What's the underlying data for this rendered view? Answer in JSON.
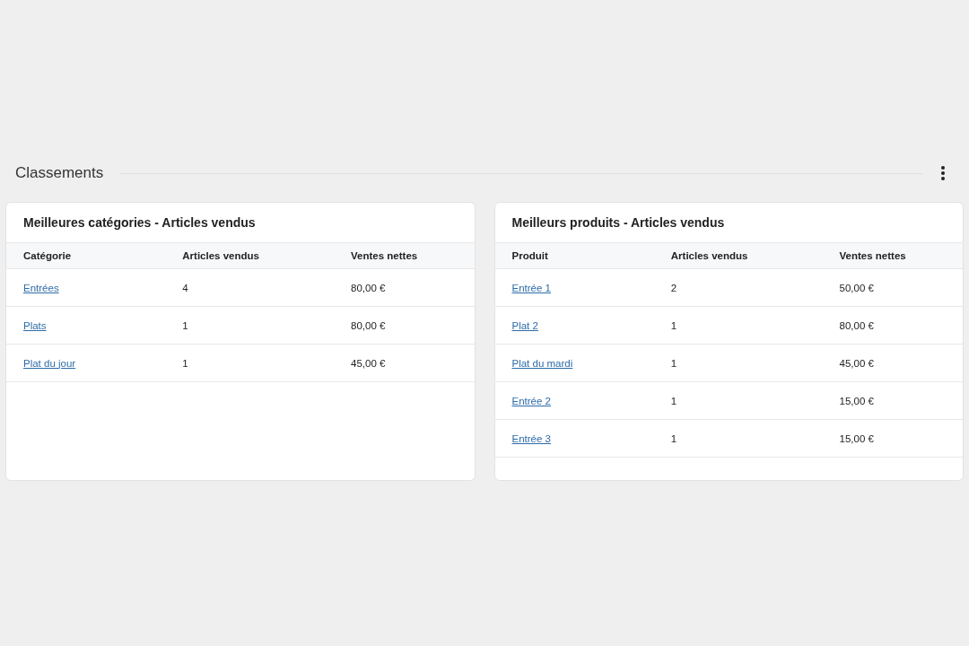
{
  "section": {
    "title": "Classements"
  },
  "cards": [
    {
      "title": "Meilleures catégories - Articles vendus",
      "columns": [
        "Catégorie",
        "Articles vendus",
        "Ventes nettes"
      ],
      "rows": [
        {
          "name": "Entrées",
          "sold": "4",
          "sales": "80,00 €"
        },
        {
          "name": "Plats",
          "sold": "1",
          "sales": "80,00 €"
        },
        {
          "name": "Plat du jour",
          "sold": "1",
          "sales": "45,00 €"
        }
      ]
    },
    {
      "title": "Meilleurs produits - Articles vendus",
      "columns": [
        "Produit",
        "Articles vendus",
        "Ventes nettes"
      ],
      "rows": [
        {
          "name": "Entrée 1",
          "sold": "2",
          "sales": "50,00 €"
        },
        {
          "name": "Plat 2",
          "sold": "1",
          "sales": "80,00 €"
        },
        {
          "name": "Plat du mardi",
          "sold": "1",
          "sales": "45,00 €"
        },
        {
          "name": "Entrée 2",
          "sold": "1",
          "sales": "15,00 €"
        },
        {
          "name": "Entrée 3",
          "sold": "1",
          "sales": "15,00 €"
        }
      ]
    }
  ]
}
